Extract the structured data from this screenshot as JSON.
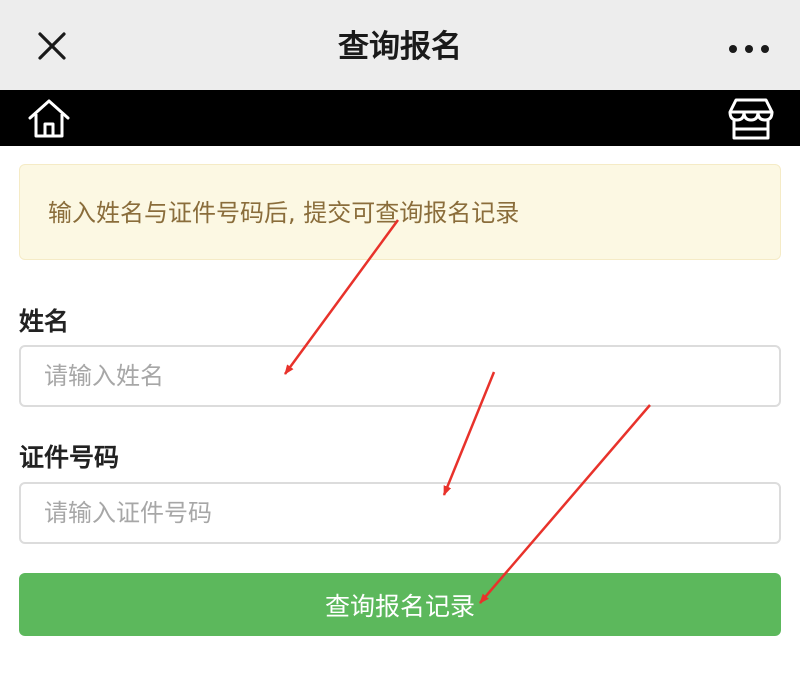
{
  "window": {
    "title": "查询报名",
    "close_icon": "close-icon",
    "more_icon": "more-dots-icon"
  },
  "nav": {
    "home_icon": "home-icon",
    "shop_icon": "shop-icon"
  },
  "notice": {
    "text": "输入姓名与证件号码后, 提交可查询报名记录"
  },
  "form": {
    "name": {
      "label": "姓名",
      "placeholder": "请输入姓名",
      "value": ""
    },
    "id": {
      "label": "证件号码",
      "placeholder": "请输入证件号码",
      "value": ""
    },
    "submit_label": "查询报名记录"
  },
  "colors": {
    "titlebar_bg": "#ededed",
    "navbar_bg": "#000000",
    "notice_bg": "#fcf8e3",
    "notice_text": "#8a6d3b",
    "button_bg": "#5cb85c",
    "annotation_arrow": "#e8322b"
  }
}
